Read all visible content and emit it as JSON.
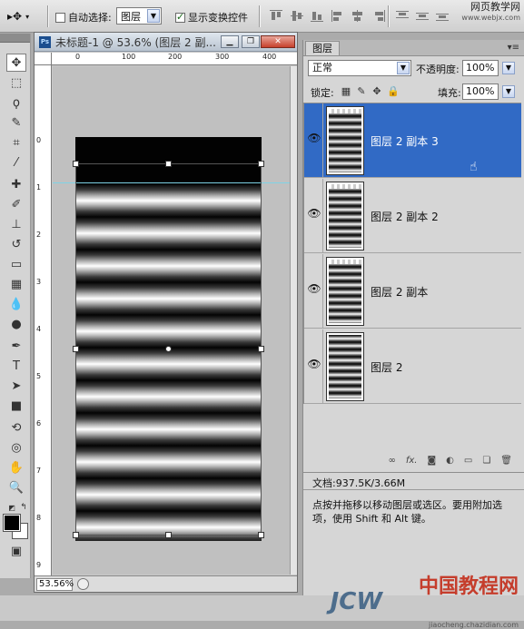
{
  "options_bar": {
    "auto_select_label": "自动选择:",
    "auto_select_checked": false,
    "layer_select_value": "图层",
    "show_transform_label": "显示变换控件",
    "show_transform_checked": true
  },
  "watermark_top": {
    "name": "网页教学网",
    "url": "www.webjx.com"
  },
  "document": {
    "title": "未标题-1 @ 53.6% (图层 2 副...",
    "zoom": "53.56%",
    "ruler_h_labels": [
      "0",
      "100",
      "200",
      "300",
      "400"
    ],
    "ruler_v_labels": [
      "0",
      "1",
      "2",
      "3",
      "4",
      "5",
      "6",
      "7",
      "8",
      "9"
    ]
  },
  "panel": {
    "tab_label": "图层",
    "blend_mode": "正常",
    "opacity_label": "不透明度:",
    "opacity_value": "100%",
    "lock_label": "锁定:",
    "fill_label": "填充:",
    "fill_value": "100%",
    "layers": [
      {
        "name": "图层 2 副本 3",
        "selected": true,
        "visible": true
      },
      {
        "name": "图层 2 副本 2",
        "selected": false,
        "visible": true
      },
      {
        "name": "图层 2 副本",
        "selected": false,
        "visible": true
      },
      {
        "name": "图层 2",
        "selected": false,
        "visible": true
      }
    ],
    "doc_size": "文档:937.5K/3.66M",
    "help_text": "点按并拖移以移动图层或选区。要用附加选项，使用 Shift 和 Alt 键。"
  },
  "watermark_bottom": {
    "line1": "中国教程网",
    "brand": "JCW",
    "url": "jiaocheng.chazidian.com"
  },
  "colors": {
    "selection": "#316ac5",
    "foreground": "#000000",
    "background": "#ffffff"
  }
}
